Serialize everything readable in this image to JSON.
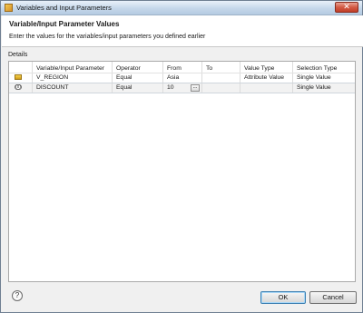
{
  "window": {
    "title": "Variables and Input Parameters",
    "close_glyph": "✕"
  },
  "header": {
    "title": "Variable/Input Parameter Values",
    "subtitle": "Enter the values for the variables/input parameters you defined earlier"
  },
  "details_label": "Details",
  "table": {
    "columns": [
      "Variable/Input Parameter",
      "Operator",
      "From",
      "To",
      "Value Type",
      "Selection Type"
    ],
    "rows": [
      {
        "icon": "variable-icon",
        "name": "V_REGION",
        "operator": "Equal",
        "from": "Asia",
        "to": "",
        "value_type": "Attribute Value",
        "selection_type": "Single Value"
      },
      {
        "icon": "input-parameter-icon",
        "name": "DISCOUNT",
        "operator": "Equal",
        "from": "10",
        "to": "",
        "value_type": "",
        "selection_type": "Single Value"
      }
    ],
    "browse_button_label": "...",
    "param_icon_glyph": "(x)"
  },
  "footer": {
    "help_glyph": "?",
    "ok_label": "OK",
    "cancel_label": "Cancel"
  }
}
